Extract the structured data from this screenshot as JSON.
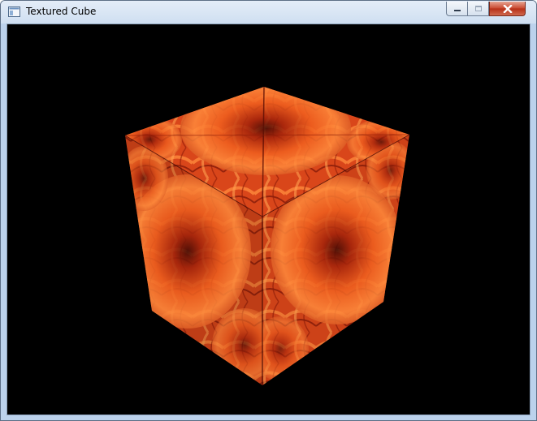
{
  "window": {
    "title": "Textured Cube",
    "icon": "app-window-icon",
    "controls": {
      "minimize": "minimize-icon",
      "maximize": "maximize-icon",
      "close": "close-icon"
    }
  },
  "scene": {
    "background": "#000000",
    "object": "cube",
    "texture": "orange-dahlia-flower",
    "colors": {
      "highlight": "#ff8a3c",
      "base": "#e0481a",
      "shadow": "#7a1406",
      "deep": "#3d0703"
    }
  }
}
